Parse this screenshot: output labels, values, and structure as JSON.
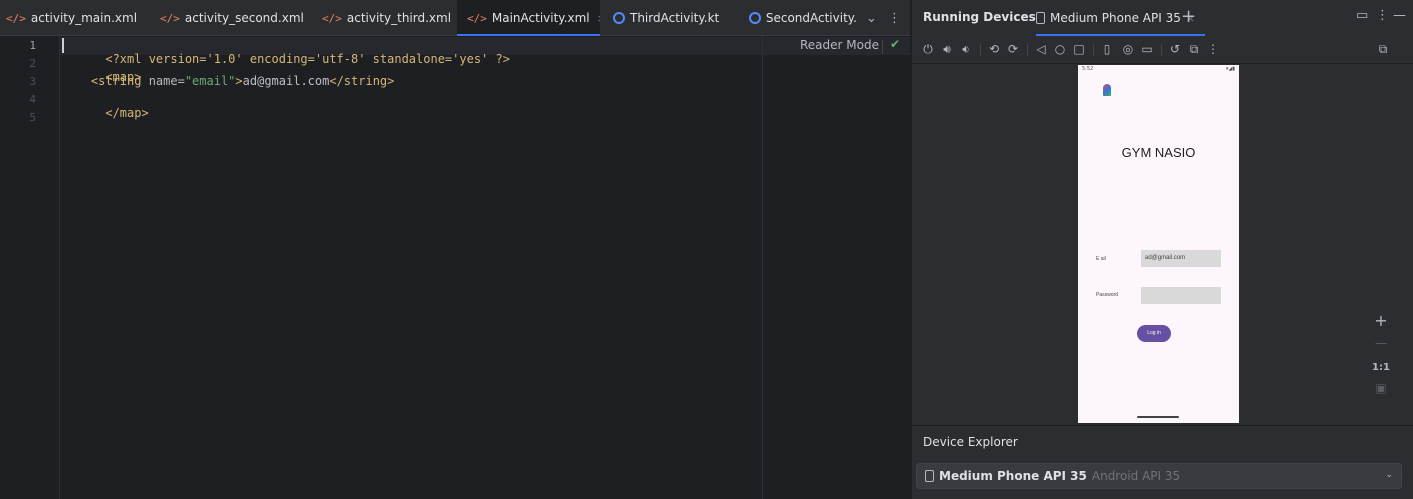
{
  "editor": {
    "tabs": [
      {
        "label": "activity_main.xml",
        "icon": "xml-icon",
        "active": false
      },
      {
        "label": "activity_second.xml",
        "icon": "xml-icon",
        "active": false
      },
      {
        "label": "activity_third.xml",
        "icon": "xml-icon",
        "active": false
      },
      {
        "label": "MainActivity.xml",
        "icon": "xml-icon",
        "active": true
      },
      {
        "label": "ThirdActivity.kt",
        "icon": "kotlin-class-icon",
        "active": false
      },
      {
        "label": "SecondActivity.",
        "icon": "kotlin-class-icon",
        "active": false
      }
    ],
    "tab_close_glyph": "×",
    "xml_icon_glyph": "</>",
    "overflow_chevron_glyph": "⌄",
    "more_glyph": "⋮",
    "reader_mode_label": "Reader Mode",
    "check_glyph": "✔",
    "line_numbers": [
      "1",
      "2",
      "3",
      "4",
      "5"
    ],
    "code_lines": [
      {
        "decl": "<?xml version='1.0' encoding='utf-8' standalone='yes' ?>"
      },
      {
        "open": "<map>"
      },
      {
        "indent": "    ",
        "open": "<string ",
        "attr": "name=",
        "val": "\"email\"",
        "close_bracket": ">",
        "text": "ad@gmail.com",
        "end": "</string>"
      },
      {
        "close": "</map>"
      }
    ],
    "colors": {
      "background": "#1e1f22",
      "tab_bar": "#2b2d30",
      "active_underline": "#3574f0",
      "tag": "#d5b778",
      "string": "#6aab73"
    }
  },
  "devices": {
    "title": "Running Devices",
    "tab_label": "Medium Phone API 35",
    "tab_close_glyph": "×",
    "add_glyph": "+",
    "header_icons": [
      {
        "name": "window-icon",
        "glyph": "▭"
      },
      {
        "name": "more-icon",
        "glyph": "⋮"
      },
      {
        "name": "minimize-icon",
        "glyph": "—"
      }
    ],
    "toolbar": [
      {
        "name": "power-icon",
        "glyph": "⏻"
      },
      {
        "name": "volume-up-icon",
        "glyph": "🔊︎"
      },
      {
        "name": "volume-down-icon",
        "glyph": "🔉︎"
      },
      {
        "name": "rotate-left-icon",
        "glyph": "⟲"
      },
      {
        "name": "rotate-right-icon",
        "glyph": "⟳"
      },
      {
        "name": "back-icon",
        "glyph": "◁"
      },
      {
        "name": "home-icon",
        "glyph": "○"
      },
      {
        "name": "overview-icon",
        "glyph": "□"
      },
      {
        "name": "device-frame-icon",
        "glyph": "▯"
      },
      {
        "name": "screenshot-icon",
        "glyph": "◎"
      },
      {
        "name": "screen-record-icon",
        "glyph": "▭"
      },
      {
        "name": "snapshot-icon",
        "glyph": "↺"
      },
      {
        "name": "extended-controls-icon",
        "glyph": "⧉"
      },
      {
        "name": "toolbar-more-icon",
        "glyph": "⋮"
      }
    ],
    "device_manager_icon": "⧉",
    "phone": {
      "status_time": "5:52",
      "status_indicators": "▾◢▮",
      "app_title": "GYM NASIO",
      "email_label": "E ail",
      "email_value": "ad@gmail.com",
      "password_label": "Password",
      "password_value": "",
      "login_button": "Log in",
      "background": "#fdf7fd",
      "button_color": "#6750a4"
    },
    "zoom": {
      "zoom_in": "+",
      "zoom_out": "—",
      "actual_size": "1:1",
      "fit_icon": "▣"
    },
    "explorer": {
      "title": "Device Explorer",
      "device_name": "Medium Phone API 35",
      "device_sub": "Android API 35",
      "chevron_glyph": "⌄"
    }
  }
}
